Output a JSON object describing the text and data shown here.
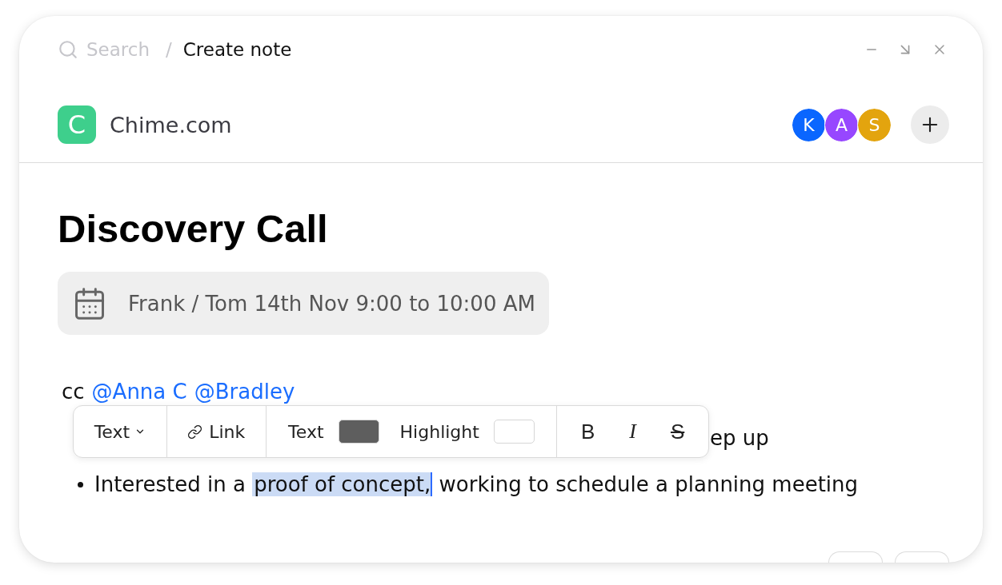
{
  "header": {
    "search": {
      "placeholder": "Search"
    },
    "separator": "/",
    "title": "Create note"
  },
  "workspace": {
    "logo_letter": "C",
    "name": "Chime.com"
  },
  "collaborators": [
    {
      "initial": "K",
      "color": "#0a66ff"
    },
    {
      "initial": "A",
      "color": "#9747ff"
    },
    {
      "initial": "S",
      "color": "#e3a40e"
    }
  ],
  "note": {
    "title": "Discovery Call",
    "event": "Frank / Tom 14th Nov 9:00 to 10:00 AM",
    "cc": {
      "prefix": "cc",
      "mentions": [
        "@Anna C",
        "@Bradley"
      ]
    },
    "bullets": [
      {
        "kind": "partial",
        "segments": [
          {
            "text": "ep up",
            "selected": false
          }
        ]
      },
      {
        "kind": "bullet",
        "segments": [
          {
            "text": "Interested in a ",
            "selected": false
          },
          {
            "text": "proof of concept,",
            "selected": true
          },
          {
            "text": " working to schedule a planning meeting",
            "selected": false
          }
        ]
      }
    ]
  },
  "toolbar": {
    "style_dropdown": "Text",
    "link": "Link",
    "colors": [
      {
        "label": "Text",
        "color": "#5e5e5e"
      },
      {
        "label": "Highlight",
        "color": "#ffffff"
      }
    ],
    "formats": [
      {
        "kind": "bold",
        "label": "B"
      },
      {
        "kind": "italic",
        "label": "I"
      },
      {
        "kind": "strikethrough",
        "label": "S"
      }
    ]
  }
}
